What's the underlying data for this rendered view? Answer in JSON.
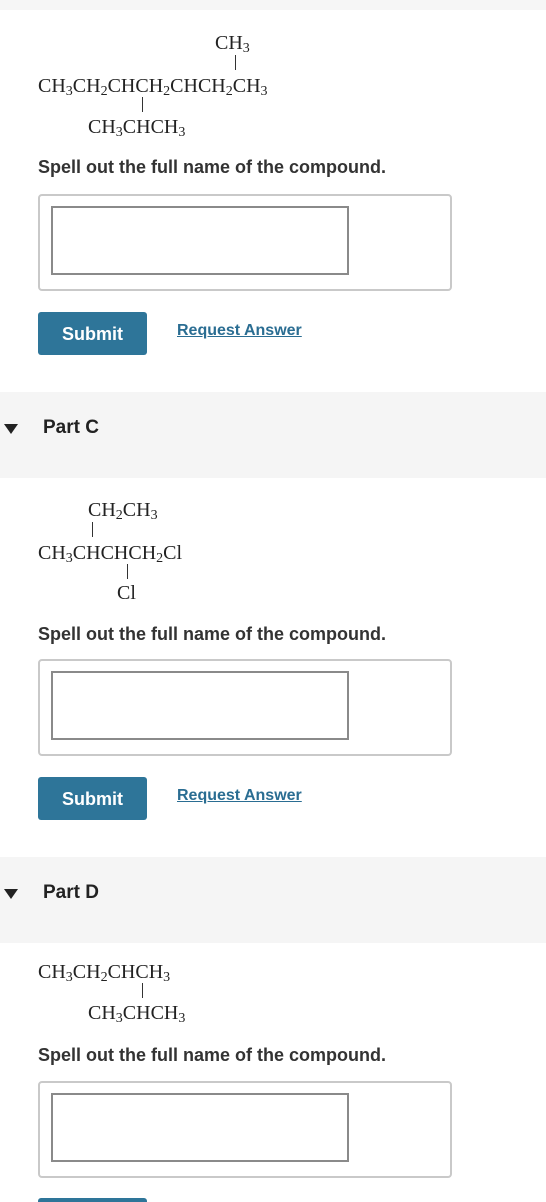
{
  "part_b": {
    "formula": {
      "top": [
        "CH",
        "3"
      ],
      "main": [
        "CH",
        "3",
        "CH",
        "2",
        "CHCH",
        "2",
        "CHCH",
        "2",
        "CH",
        "3"
      ],
      "bottom": [
        "CH",
        "3",
        "CHCH",
        "3"
      ]
    },
    "prompt": "Spell out the full name of the compound.",
    "answer_value": "",
    "submit_label": "Submit",
    "request_label": "Request Answer"
  },
  "part_c": {
    "label": "Part C",
    "formula": {
      "top": [
        "CH",
        "2",
        "CH",
        "3"
      ],
      "main": [
        "CH",
        "3",
        "CHCHCH",
        "2",
        "Cl"
      ],
      "bottom": "Cl"
    },
    "prompt": "Spell out the full name of the compound.",
    "answer_value": "",
    "submit_label": "Submit",
    "request_label": "Request Answer"
  },
  "part_d": {
    "label": "Part D",
    "formula": {
      "main": [
        "CH",
        "3",
        "CH",
        "2",
        "CHCH",
        "3"
      ],
      "bottom": [
        "CH",
        "3",
        "CHCH",
        "3"
      ]
    },
    "prompt": "Spell out the full name of the compound.",
    "answer_value": ""
  },
  "colors": {
    "accent": "#2e7599",
    "link": "#2a6d92",
    "band": "#f5f5f5"
  }
}
